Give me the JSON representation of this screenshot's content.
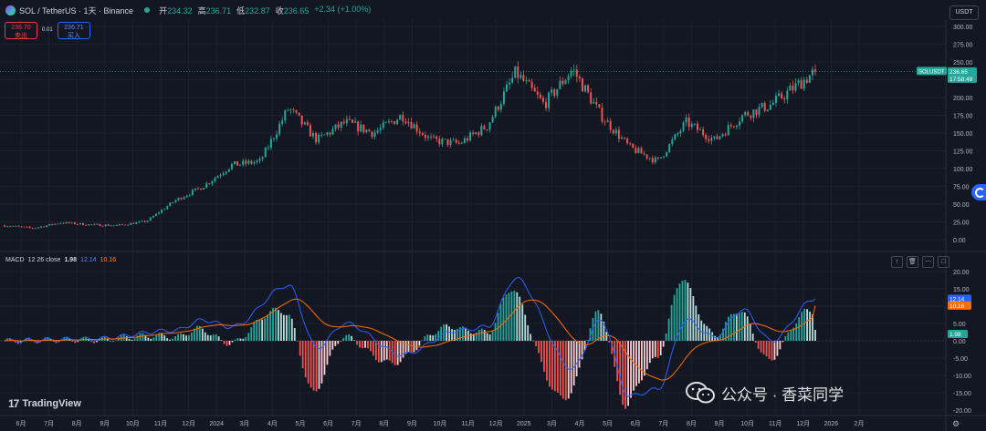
{
  "header": {
    "title": "SOL / TetherUS · 1天 · Binance",
    "ohlc": [
      {
        "k": "开",
        "v": "234.32"
      },
      {
        "k": "高",
        "v": "236.71"
      },
      {
        "k": "低",
        "v": "232.87"
      },
      {
        "k": "收",
        "v": "236.65"
      },
      {
        "k": "",
        "v": "+2.34 (+1.00%)"
      }
    ],
    "sell_price": "236.70",
    "sell_label": "卖出",
    "buy_price": "236.71",
    "buy_label": "买入",
    "spread": "0.01",
    "currency": "USDT"
  },
  "colors": {
    "background": "#131722",
    "up": "#26a69a",
    "down": "#ef5350",
    "macd_line": "#2962ff",
    "signal_line": "#ff6d00",
    "grid": "#1e222d",
    "text": "#b2b5be"
  },
  "price_tag": {
    "symbol": "SOLUSDT",
    "price": "236.65",
    "countdown": "17:58:49"
  },
  "macd_legend": {
    "name": "MACD",
    "params": "12 26 close",
    "hist": "1.98",
    "macd": "12.14",
    "signal": "10.16"
  },
  "macd_tags": {
    "macd": "12.14",
    "signal": "10.16",
    "hist": "1.98"
  },
  "branding": {
    "tradingview": "TradingView",
    "watermark": "公众号 · 香菜同学"
  },
  "chart_data": {
    "type": "candlestick",
    "price_axis": {
      "ylim": [
        -10,
        300
      ],
      "ticks": [
        "300.00",
        "275.00",
        "250.00",
        "225.00",
        "200.00",
        "175.00",
        "150.00",
        "125.00",
        "100.00",
        "75.00",
        "50.00",
        "25.00",
        "0.00"
      ]
    },
    "macd_axis": {
      "ylim": [
        -20,
        20
      ],
      "ticks": [
        "20.00",
        "15.00",
        "10.00",
        "5.00",
        "0.00",
        "-5.00",
        "-10.00",
        "-15.00",
        "-20.00"
      ]
    },
    "x_ticks": [
      "6月",
      "7月",
      "8月",
      "9月",
      "10月",
      "11月",
      "12月",
      "2024",
      "3月",
      "4月",
      "5月",
      "6月",
      "7月",
      "8月",
      "9月",
      "10月",
      "11月",
      "12月",
      "2025",
      "3月",
      "4月",
      "5月",
      "6月",
      "7月",
      "8月",
      "9月",
      "10月",
      "11月",
      "12月",
      "2026",
      "2月"
    ],
    "close_path": [
      {
        "date": "2023-05",
        "close": 20
      },
      {
        "date": "2023-06",
        "close": 16
      },
      {
        "date": "2023-07",
        "close": 24
      },
      {
        "date": "2023-08",
        "close": 21
      },
      {
        "date": "2023-09",
        "close": 20
      },
      {
        "date": "2023-10",
        "close": 26
      },
      {
        "date": "2023-11",
        "close": 55
      },
      {
        "date": "2023-12",
        "close": 75
      },
      {
        "date": "2024-01",
        "close": 105
      },
      {
        "date": "2024-02",
        "close": 110
      },
      {
        "date": "2024-03",
        "close": 185
      },
      {
        "date": "2024-04",
        "close": 140
      },
      {
        "date": "2024-05",
        "close": 165
      },
      {
        "date": "2024-06",
        "close": 150
      },
      {
        "date": "2024-07",
        "close": 175
      },
      {
        "date": "2024-08",
        "close": 140
      },
      {
        "date": "2024-09",
        "close": 135
      },
      {
        "date": "2024-10",
        "close": 160
      },
      {
        "date": "2024-11",
        "close": 235
      },
      {
        "date": "2024-12",
        "close": 190
      },
      {
        "date": "2025-01",
        "close": 240
      },
      {
        "date": "2025-02",
        "close": 175
      },
      {
        "date": "2025-03",
        "close": 130
      },
      {
        "date": "2025-04",
        "close": 110
      },
      {
        "date": "2025-05",
        "close": 165
      },
      {
        "date": "2025-06",
        "close": 140
      },
      {
        "date": "2025-07",
        "close": 175
      },
      {
        "date": "2025-08",
        "close": 190
      },
      {
        "date": "2025-09",
        "close": 236.65
      }
    ],
    "macd_path": [
      {
        "date": "2023-05",
        "macd": 0
      },
      {
        "date": "2023-08",
        "macd": 0.5
      },
      {
        "date": "2023-11",
        "macd": 3
      },
      {
        "date": "2023-12",
        "macd": 6
      },
      {
        "date": "2024-01",
        "macd": 4
      },
      {
        "date": "2024-03",
        "macd": 16
      },
      {
        "date": "2024-04",
        "macd": -2
      },
      {
        "date": "2024-05",
        "macd": 5
      },
      {
        "date": "2024-07",
        "macd": -4
      },
      {
        "date": "2024-09",
        "macd": 3
      },
      {
        "date": "2024-10",
        "macd": 4
      },
      {
        "date": "2024-11",
        "macd": 18
      },
      {
        "date": "2025-01",
        "macd": -8
      },
      {
        "date": "2025-02",
        "macd": 6
      },
      {
        "date": "2025-03",
        "macd": -16
      },
      {
        "date": "2025-04",
        "macd": -14
      },
      {
        "date": "2025-05",
        "macd": 6
      },
      {
        "date": "2025-06",
        "macd": 1
      },
      {
        "date": "2025-07",
        "macd": 9
      },
      {
        "date": "2025-08",
        "macd": 0
      },
      {
        "date": "2025-09",
        "macd": 12.14
      }
    ]
  }
}
